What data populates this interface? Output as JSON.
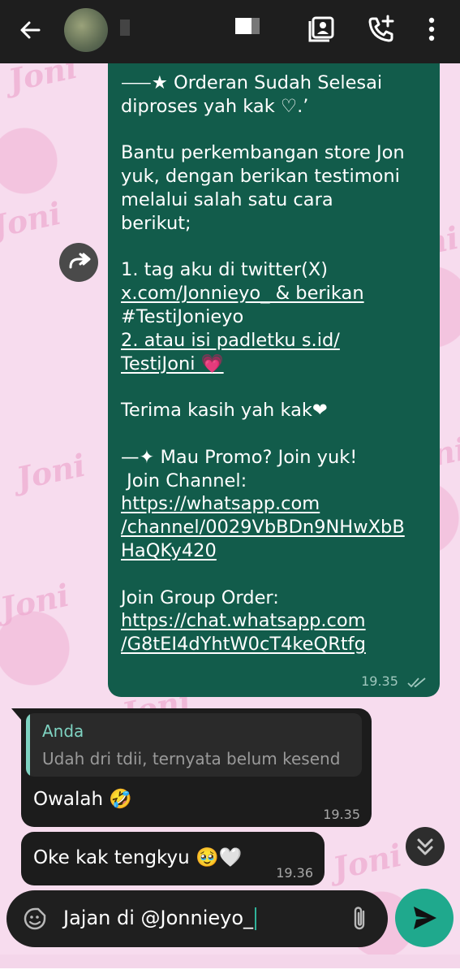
{
  "header": {
    "contact_name": "",
    "icons": [
      "back-arrow-icon",
      "contact-card-icon",
      "add-call-icon",
      "more-vertical-icon"
    ]
  },
  "messages": {
    "outgoing": {
      "text_lines": [
        "⸺★ Orderan Sudah Selesai",
        "diproses yah kak ♡.’",
        "",
        "Bantu perkembangan store Jon",
        "yuk, dengan berikan testimoni",
        "melalui salah satu cara",
        "berikut;",
        "",
        "1. tag aku di twitter(X)",
        "x.com/Jonnieyo_ & berikan",
        "#TestiJonieyo",
        "2. atau isi padletku s.id/",
        "TestiJoni 💗",
        "",
        "Terima kasih yah kak❤",
        "",
        "—✦ Mau Promo? Join yuk!",
        " Join Channel:",
        "https://whatsapp.com",
        "/channel/0029VbBDn9NHwXbB",
        "HaQKy420",
        "",
        "Join Group Order:",
        "https://chat.whatsapp.com",
        "/G8tEI4dYhtW0cT4keQRtfg"
      ],
      "time": "19.35"
    },
    "incoming_1": {
      "quote_author": "Anda",
      "quote_text": "Udah dri tdii, ternyata belum kesend",
      "text": "Owalah 🤣",
      "time": "19.35"
    },
    "incoming_2": {
      "text": "Oke kak tengkyu 🥹🤍",
      "time": "19.36"
    }
  },
  "composer": {
    "value": "Jajan di @Jonnieyo_"
  },
  "colors": {
    "header_bg": "#1e1e1e",
    "outgoing_bubble": "#125c4b",
    "incoming_bubble": "#1c1c1c",
    "accent": "#1fa98d",
    "quote_accent": "#7fd3c2"
  }
}
